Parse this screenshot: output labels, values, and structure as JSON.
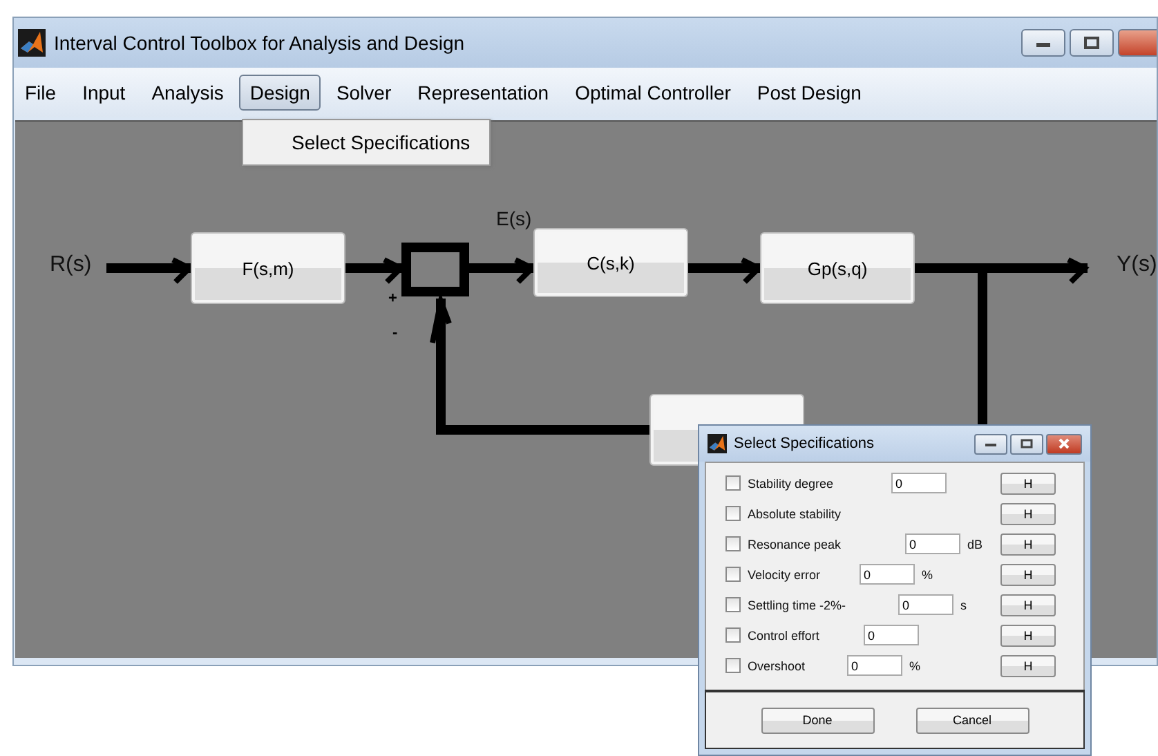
{
  "window": {
    "title": "Interval Control Toolbox for Analysis and Design"
  },
  "menu": [
    {
      "label": "File",
      "selected": false
    },
    {
      "label": "Input",
      "selected": false
    },
    {
      "label": "Analysis",
      "selected": false
    },
    {
      "label": "Design",
      "selected": true
    },
    {
      "label": "Solver",
      "selected": false
    },
    {
      "label": "Representation",
      "selected": false
    },
    {
      "label": "Optimal Controller",
      "selected": false
    },
    {
      "label": "Post Design",
      "selected": false
    }
  ],
  "dropdown": {
    "items": [
      "Select Specifications"
    ]
  },
  "diagram": {
    "signals": [
      "R(s)",
      "E(s)",
      "Y(s)"
    ],
    "signs": [
      "+",
      "-"
    ],
    "blocks": [
      {
        "label": "F(s,m)"
      },
      {
        "label": "C(s,k)"
      },
      {
        "label": "Gp(s,q)"
      }
    ]
  },
  "dialog": {
    "title": "Select Specifications",
    "rows": [
      {
        "label": "Stability degree",
        "checked": false,
        "value": "0",
        "button": "H"
      },
      {
        "label": "Absolute stability",
        "checked": false,
        "button": "H"
      },
      {
        "label": "Resonance peak",
        "checked": false,
        "value": "0",
        "unit": "dB",
        "button": "H"
      },
      {
        "label": "Velocity error",
        "checked": false,
        "value": "0",
        "unit": "%",
        "button": "H"
      },
      {
        "label": "Settling time -2%-",
        "checked": false,
        "value": "0",
        "unit": "s",
        "button": "H"
      },
      {
        "label": "Control effort",
        "checked": false,
        "value": "0",
        "button": "H"
      },
      {
        "label": "Overshoot",
        "checked": false,
        "value": "0",
        "unit": "%",
        "button": "H"
      }
    ],
    "buttons": [
      "Done",
      "Cancel"
    ]
  }
}
